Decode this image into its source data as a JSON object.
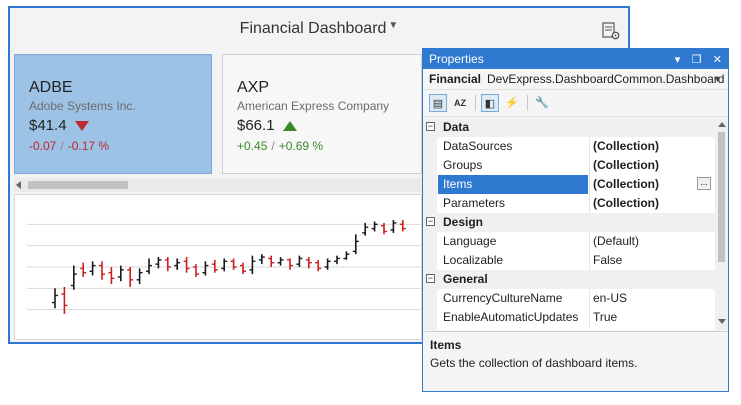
{
  "dashboard": {
    "title": "Financial Dashboard",
    "cards": [
      {
        "symbol": "ADBE",
        "name": "Adobe Systems Inc.",
        "price": "$41.4",
        "direction": "down",
        "abs_change": "-0.07",
        "pct_change": "-0.17 %",
        "selected": true
      },
      {
        "symbol": "AXP",
        "name": "American Express Company",
        "price": "$66.1",
        "direction": "up",
        "abs_change": "+0.45",
        "pct_change": "+0.69 %",
        "selected": false
      }
    ],
    "separator": "/",
    "icons": {
      "settings": "dashboard-settings-icon",
      "filter": "dropdown-arrow-icon"
    },
    "colors": {
      "accent": "#2f7ad0",
      "selected_card": "#9cc3e6",
      "down": "#c0262d",
      "up": "#3a8a2c"
    }
  },
  "chart_data": {
    "type": "candlestick",
    "title": "",
    "xlabel": "",
    "ylabel": "",
    "grid": true,
    "series": [
      {
        "values": [
          {
            "o": 2.0,
            "c": 2.5,
            "h": 3.0,
            "l": 1.6
          },
          {
            "o": 2.6,
            "c": 1.8,
            "h": 3.1,
            "l": 1.2
          },
          {
            "o": 3.2,
            "c": 4.0,
            "h": 4.6,
            "l": 2.9
          },
          {
            "o": 4.4,
            "c": 4.1,
            "h": 4.8,
            "l": 3.8
          },
          {
            "o": 4.2,
            "c": 4.6,
            "h": 4.9,
            "l": 3.9
          },
          {
            "o": 4.6,
            "c": 4.0,
            "h": 4.9,
            "l": 3.6
          },
          {
            "o": 4.1,
            "c": 3.7,
            "h": 4.5,
            "l": 3.3
          },
          {
            "o": 3.8,
            "c": 4.3,
            "h": 4.6,
            "l": 3.5
          },
          {
            "o": 4.3,
            "c": 3.6,
            "h": 4.5,
            "l": 3.1
          },
          {
            "o": 3.6,
            "c": 4.1,
            "h": 4.4,
            "l": 3.3
          },
          {
            "o": 4.2,
            "c": 4.6,
            "h": 5.1,
            "l": 4.0
          },
          {
            "o": 4.7,
            "c": 5.0,
            "h": 5.2,
            "l": 4.4
          },
          {
            "o": 5.0,
            "c": 4.5,
            "h": 5.2,
            "l": 4.2
          },
          {
            "o": 4.6,
            "c": 4.8,
            "h": 5.1,
            "l": 4.3
          },
          {
            "o": 4.9,
            "c": 4.4,
            "h": 5.2,
            "l": 4.1
          },
          {
            "o": 4.5,
            "c": 4.0,
            "h": 4.7,
            "l": 3.8
          },
          {
            "o": 4.1,
            "c": 4.6,
            "h": 4.9,
            "l": 3.9
          },
          {
            "o": 4.7,
            "c": 4.3,
            "h": 5.0,
            "l": 4.1
          },
          {
            "o": 4.4,
            "c": 4.9,
            "h": 5.1,
            "l": 4.2
          },
          {
            "o": 4.9,
            "c": 4.5,
            "h": 5.1,
            "l": 4.3
          },
          {
            "o": 4.6,
            "c": 4.2,
            "h": 4.8,
            "l": 4.0
          },
          {
            "o": 4.3,
            "c": 4.9,
            "h": 5.3,
            "l": 4.0
          },
          {
            "o": 5.0,
            "c": 5.2,
            "h": 5.4,
            "l": 4.7
          },
          {
            "o": 5.1,
            "c": 4.8,
            "h": 5.3,
            "l": 4.5
          },
          {
            "o": 4.8,
            "c": 5.0,
            "h": 5.2,
            "l": 4.6
          },
          {
            "o": 5.0,
            "c": 4.6,
            "h": 5.1,
            "l": 4.3
          },
          {
            "o": 4.7,
            "c": 5.1,
            "h": 5.3,
            "l": 4.5
          },
          {
            "o": 5.0,
            "c": 4.8,
            "h": 5.2,
            "l": 4.4
          },
          {
            "o": 4.8,
            "c": 4.4,
            "h": 5.0,
            "l": 4.2
          },
          {
            "o": 4.5,
            "c": 4.9,
            "h": 5.1,
            "l": 4.3
          },
          {
            "o": 4.9,
            "c": 5.1,
            "h": 5.3,
            "l": 4.7
          },
          {
            "o": 5.1,
            "c": 5.4,
            "h": 5.6,
            "l": 5.0
          },
          {
            "o": 5.6,
            "c": 6.3,
            "h": 6.8,
            "l": 5.4
          },
          {
            "o": 6.9,
            "c": 7.3,
            "h": 7.6,
            "l": 6.7
          },
          {
            "o": 7.2,
            "c": 7.5,
            "h": 7.7,
            "l": 7.0
          },
          {
            "o": 7.4,
            "c": 7.0,
            "h": 7.6,
            "l": 6.8
          },
          {
            "o": 7.1,
            "c": 7.6,
            "h": 7.8,
            "l": 6.9
          },
          {
            "o": 7.5,
            "c": 7.2,
            "h": 7.8,
            "l": 7.0
          }
        ]
      }
    ],
    "ylim": [
      0,
      9
    ],
    "up_color": "#1a1a1a",
    "down_color": "#cc1f1f"
  },
  "properties": {
    "title": "Properties",
    "title_buttons": [
      "▾",
      "❐",
      "✕"
    ],
    "object_name": "Financial",
    "object_type": "DevExpress.DashboardCommon.Dashboard",
    "toolbar": [
      {
        "name": "categorized-icon",
        "glyph": "▤",
        "active": true
      },
      {
        "name": "alphabetical-icon",
        "glyph": "AZ",
        "active": false
      },
      {
        "name": "properties-icon",
        "glyph": "◧",
        "active": true
      },
      {
        "name": "events-icon",
        "glyph": "⚡",
        "active": false
      },
      {
        "name": "property-pages-icon",
        "glyph": "🔧",
        "active": false
      }
    ],
    "rows": [
      {
        "kind": "cat",
        "label": "Data",
        "toggle": "−"
      },
      {
        "kind": "prop",
        "name": "DataSources",
        "value": "(Collection)",
        "bold": true
      },
      {
        "kind": "prop",
        "name": "Groups",
        "value": "(Collection)",
        "bold": true
      },
      {
        "kind": "prop",
        "name": "Items",
        "value": "(Collection)",
        "bold": true,
        "selected": true,
        "ellipsis": "..."
      },
      {
        "kind": "prop",
        "name": "Parameters",
        "value": "(Collection)",
        "bold": true
      },
      {
        "kind": "cat",
        "label": "Design",
        "toggle": "−"
      },
      {
        "kind": "prop",
        "name": "Language",
        "value": "(Default)",
        "bold": false
      },
      {
        "kind": "prop",
        "name": "Localizable",
        "value": "False",
        "bold": false
      },
      {
        "kind": "cat",
        "label": "General",
        "toggle": "−"
      },
      {
        "kind": "prop",
        "name": "CurrencyCultureName",
        "value": "en-US",
        "bold": false
      },
      {
        "kind": "prop",
        "name": "EnableAutomaticUpdates",
        "value": "True",
        "bold": false
      }
    ],
    "description_title": "Items",
    "description_text": "Gets the collection of dashboard items."
  }
}
